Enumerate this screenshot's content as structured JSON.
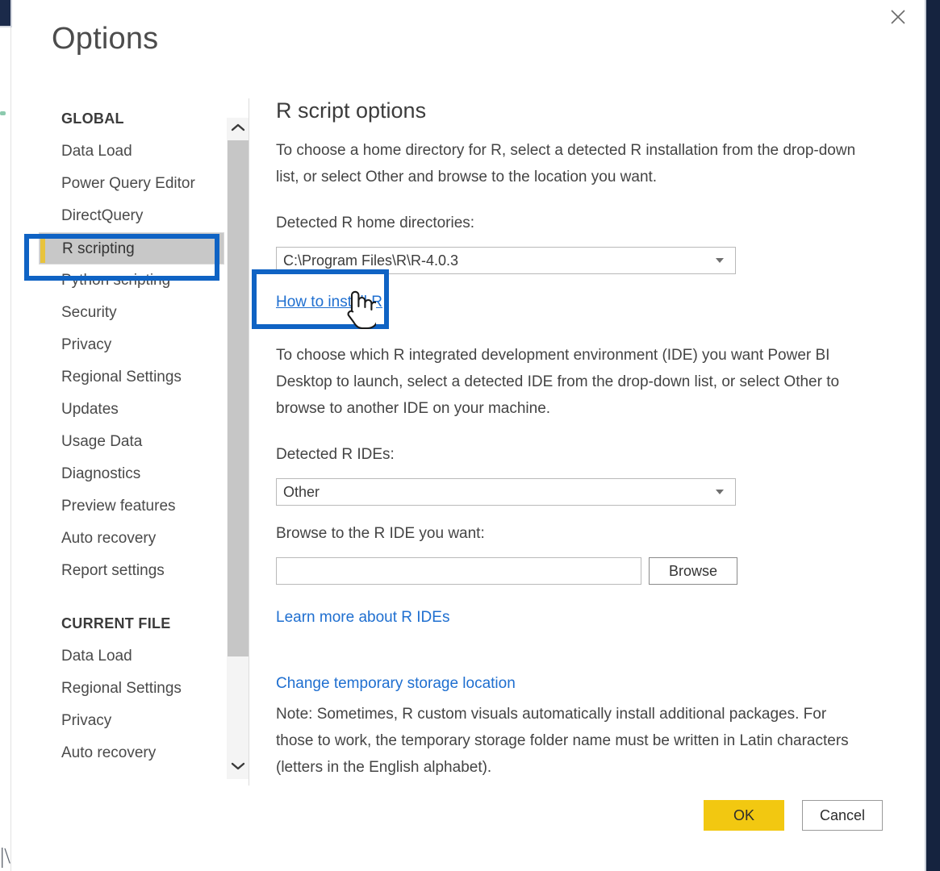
{
  "window": {
    "title": "Options",
    "close_icon": "close-icon"
  },
  "sidebar": {
    "groups": [
      {
        "header": "GLOBAL",
        "items": [
          {
            "label": "Data Load",
            "selected": false
          },
          {
            "label": "Power Query Editor",
            "selected": false
          },
          {
            "label": "DirectQuery",
            "selected": false
          },
          {
            "label": "R scripting",
            "selected": true
          },
          {
            "label": "Python scripting",
            "selected": false
          },
          {
            "label": "Security",
            "selected": false
          },
          {
            "label": "Privacy",
            "selected": false
          },
          {
            "label": "Regional Settings",
            "selected": false
          },
          {
            "label": "Updates",
            "selected": false
          },
          {
            "label": "Usage Data",
            "selected": false
          },
          {
            "label": "Diagnostics",
            "selected": false
          },
          {
            "label": "Preview features",
            "selected": false
          },
          {
            "label": "Auto recovery",
            "selected": false
          },
          {
            "label": "Report settings",
            "selected": false
          }
        ]
      },
      {
        "header": "CURRENT FILE",
        "items": [
          {
            "label": "Data Load",
            "selected": false
          },
          {
            "label": "Regional Settings",
            "selected": false
          },
          {
            "label": "Privacy",
            "selected": false
          },
          {
            "label": "Auto recovery",
            "selected": false
          }
        ]
      }
    ],
    "scrollbar": {
      "up_icon": "chevron-up-icon",
      "down_icon": "chevron-down-icon"
    }
  },
  "main": {
    "heading": "R script options",
    "intro_paragraph": "To choose a home directory for R, select a detected R installation from the drop-down list, or select Other and browse to the location you want.",
    "home_dir_label": "Detected R home directories:",
    "home_dir_value": "C:\\Program Files\\R\\R-4.0.3",
    "install_link": "How to install R",
    "ide_paragraph": "To choose which R integrated development environment (IDE) you want Power BI Desktop to launch, select a detected IDE from the drop-down list, or select Other to browse to another IDE on your machine.",
    "ide_label": "Detected R IDEs:",
    "ide_value": "Other",
    "browse_label": "Browse to the R IDE you want:",
    "browse_value": "",
    "browse_placeholder": "",
    "browse_button": "Browse",
    "learn_more_link": "Learn more about R IDEs",
    "temp_storage_link": "Change temporary storage location",
    "note_paragraph": "Note: Sometimes, R custom visuals automatically install additional packages. For those to work, the temporary storage folder name must be written in Latin characters (letters in the English alphabet)."
  },
  "footer": {
    "ok": "OK",
    "cancel": "Cancel"
  },
  "annotations": {
    "color": "#0f63c4",
    "highlight_nav_item": "R scripting",
    "highlight_link": "How to install R",
    "cursor": "hand-pointer-cursor"
  },
  "background": {
    "navy_color": "#15233f",
    "ghost_text": "|\\"
  }
}
